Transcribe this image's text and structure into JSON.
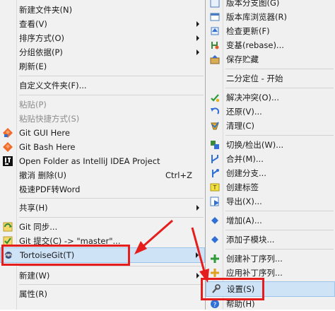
{
  "main_menu": {
    "new_folder": "新建文件夹(N)",
    "view": "查看(V)",
    "sort_by": "排序方式(O)",
    "group_by": "分组依据(P)",
    "refresh": "刷新(E)",
    "customize_folder": "自定义文件夹(F)...",
    "paste": "粘贴(P)",
    "paste_shortcut": "粘贴快捷方式(S)",
    "git_gui": "Git GUI Here",
    "git_bash": "Git Bash Here",
    "open_intellij": "Open Folder as IntelliJ IDEA Project",
    "undo_delete": "撤消 删除(U)",
    "undo_shortcut": "Ctrl+Z",
    "pdf_to_word": "极速PDF转Word",
    "share": "共享(H)",
    "git_sync": "Git 同步...",
    "git_commit": "Git 提交(C) -> \"master\"...",
    "tortoisegit": "TortoiseGit(T)",
    "new": "新建(W)",
    "properties": "属性(R)"
  },
  "sub_menu": {
    "branch_graph": "版本分支图(G)",
    "repo_browser": "版本库浏览器(R)",
    "check_updates": "检查更新(F)",
    "rebase": "变基(rebase)...",
    "stash_save": "保存贮藏",
    "bisect_start": "二分定位 - 开始",
    "resolve": "解决冲突(O)...",
    "revert": "还原(V)...",
    "cleanup": "清理(C)",
    "switch_checkout": "切换/检出(W)...",
    "merge": "合并(M)...",
    "create_branch": "创建分支...",
    "create_tag": "创建标签",
    "export": "导出(X)...",
    "add": "增加(A)...",
    "add_submodule": "添加子模块...",
    "create_patch": "创建补丁序列...",
    "apply_patch": "应用补丁序列...",
    "settings": "设置(S)",
    "help": "帮助(H)"
  },
  "colors": {
    "annotation_red": "#e61d1d",
    "hover_blue": "#cfe3f7"
  }
}
